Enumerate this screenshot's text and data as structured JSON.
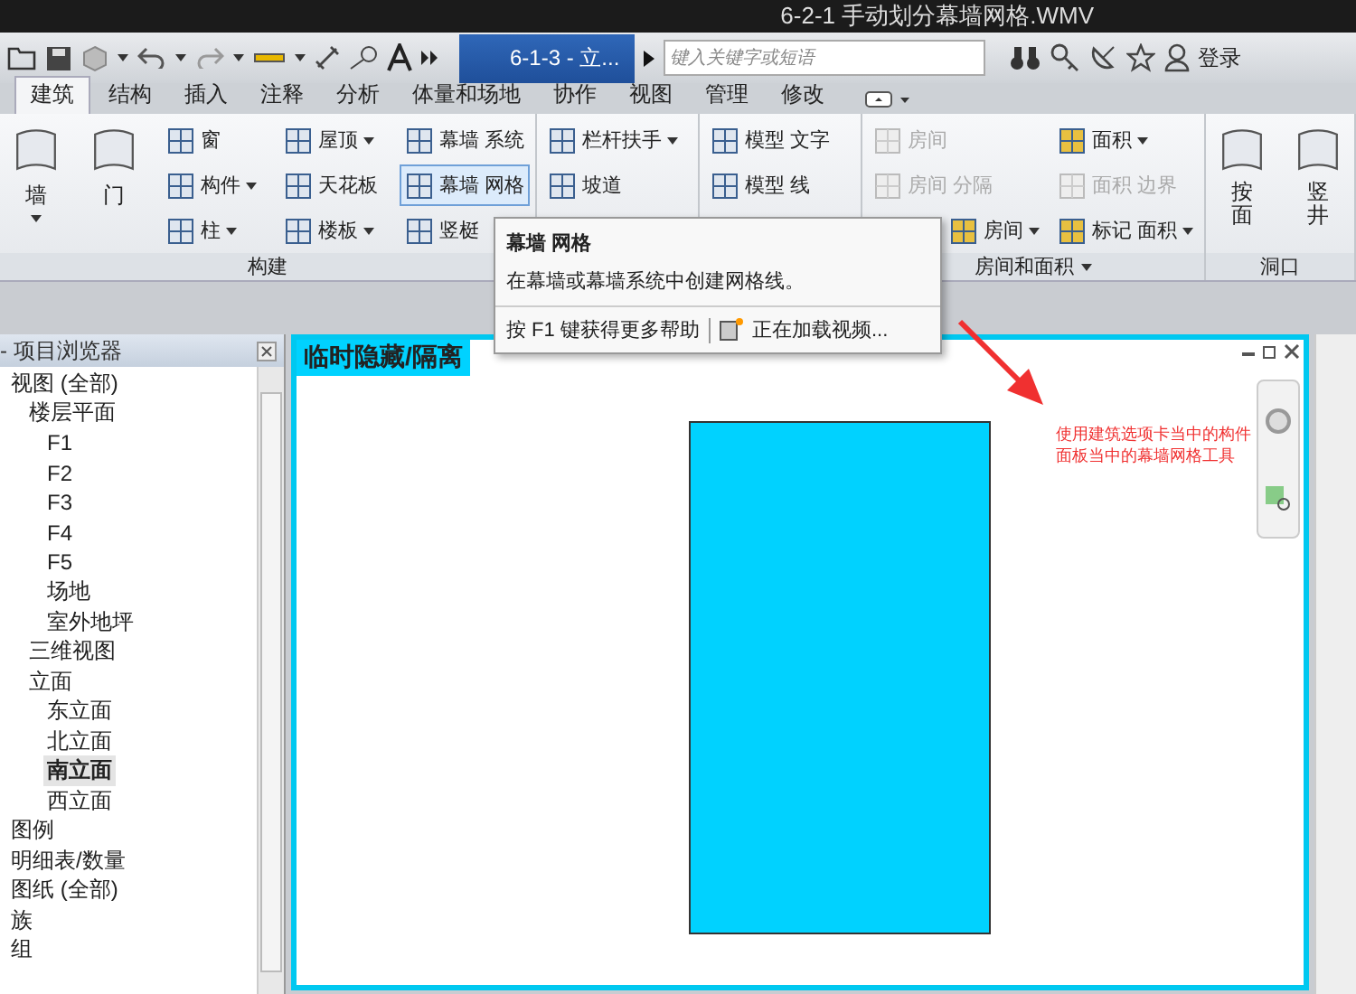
{
  "window": {
    "title": "6-2-1 手动划分幕墙网格.WMV"
  },
  "toolbar": {
    "document_tab": "6-1-3 - 立...",
    "search": {
      "placeholder": "键入关键字或短语"
    },
    "sign_in": "登录"
  },
  "ribbon": {
    "tabs": [
      {
        "label": "建筑",
        "selected": true
      },
      {
        "label": "结构",
        "selected": false
      },
      {
        "label": "插入",
        "selected": false
      },
      {
        "label": "注释",
        "selected": false
      },
      {
        "label": "分析",
        "selected": false
      },
      {
        "label": "体量和场地",
        "selected": false
      },
      {
        "label": "协作",
        "selected": false
      },
      {
        "label": "视图",
        "selected": false
      },
      {
        "label": "管理",
        "selected": false
      },
      {
        "label": "修改",
        "selected": false
      }
    ],
    "panels": [
      {
        "label": "构建",
        "menu": false,
        "large": [
          {
            "label": "墙",
            "caret": true
          },
          {
            "label": "门",
            "caret": false
          }
        ],
        "columns": [
          [
            {
              "label": "窗",
              "caret": false,
              "disabled": false,
              "highlighted": false
            },
            {
              "label": "构件",
              "caret": true,
              "disabled": false,
              "highlighted": false
            },
            {
              "label": "柱",
              "caret": true,
              "disabled": false,
              "highlighted": false
            }
          ],
          [
            {
              "label": "屋顶",
              "caret": true,
              "disabled": false,
              "highlighted": false
            },
            {
              "label": "天花板",
              "caret": false,
              "disabled": false,
              "highlighted": false
            },
            {
              "label": "楼板",
              "caret": true,
              "disabled": false,
              "highlighted": false
            }
          ],
          [
            {
              "label": "幕墙 系统",
              "caret": false,
              "disabled": false,
              "highlighted": false
            },
            {
              "label": "幕墙 网格",
              "caret": false,
              "disabled": false,
              "highlighted": true
            },
            {
              "label": "竖梃",
              "caret": false,
              "disabled": false,
              "highlighted": false
            }
          ]
        ]
      },
      {
        "columns": [
          [
            {
              "label": "栏杆扶手",
              "caret": true,
              "disabled": false,
              "highlighted": false
            },
            {
              "label": "坡道",
              "caret": false,
              "disabled": false,
              "highlighted": false
            }
          ]
        ]
      },
      {
        "columns": [
          [
            {
              "label": "模型 文字",
              "caret": false,
              "disabled": false,
              "highlighted": false
            },
            {
              "label": "模型 线",
              "caret": false,
              "disabled": false,
              "highlighted": false
            }
          ]
        ]
      },
      {
        "label": "房间和面积",
        "menu": true,
        "columns": [
          [
            {
              "label": "房间",
              "caret": false,
              "disabled": true,
              "highlighted": false
            },
            {
              "label": "房间 分隔",
              "caret": false,
              "disabled": true,
              "highlighted": false
            },
            {
              "label": "房间",
              "caret": true,
              "disabled": false,
              "highlighted": false
            }
          ],
          [
            {
              "label": "面积",
              "caret": true,
              "disabled": false,
              "highlighted": false
            },
            {
              "label": "面积 边界",
              "caret": false,
              "disabled": true,
              "highlighted": false
            },
            {
              "label": "标记 面积",
              "caret": true,
              "disabled": false,
              "highlighted": false
            }
          ]
        ]
      },
      {
        "label": "洞口",
        "menu": false,
        "large": [
          {
            "label": "按面",
            "caret": false
          },
          {
            "label": "竖井",
            "caret": false
          }
        ]
      }
    ]
  },
  "tooltip": {
    "title": "幕墙 网格",
    "description": "在幕墙或幕墙系统中创建网格线。",
    "help": "按 F1 键获得更多帮助",
    "video": "正在加载视频..."
  },
  "browser": {
    "title": "- 项目浏览器",
    "tree": [
      {
        "label": "视图 (全部)",
        "selected": false,
        "children": [
          {
            "label": "楼层平面",
            "selected": false,
            "children": [
              {
                "label": "F1",
                "selected": false
              },
              {
                "label": "F2",
                "selected": false
              },
              {
                "label": "F3",
                "selected": false
              },
              {
                "label": "F4",
                "selected": false
              },
              {
                "label": "F5",
                "selected": false
              },
              {
                "label": "场地",
                "selected": false
              },
              {
                "label": "室外地坪",
                "selected": false
              }
            ]
          },
          {
            "label": "三维视图",
            "selected": false
          },
          {
            "label": "立面",
            "selected": false,
            "children": [
              {
                "label": "东立面",
                "selected": false
              },
              {
                "label": "北立面",
                "selected": false
              },
              {
                "label": "南立面",
                "selected": true
              },
              {
                "label": "西立面",
                "selected": false
              }
            ]
          }
        ]
      },
      {
        "label": "图例",
        "selected": false
      },
      {
        "label": "明细表/数量",
        "selected": false
      },
      {
        "label": "图纸 (全部)",
        "selected": false
      },
      {
        "label": "族",
        "selected": false
      },
      {
        "label": "组",
        "selected": false
      }
    ]
  },
  "view": {
    "label": "临时隐藏/隔离",
    "annotation": "使用建筑选项卡当中的构件面板当中的幕墙网格工具"
  }
}
